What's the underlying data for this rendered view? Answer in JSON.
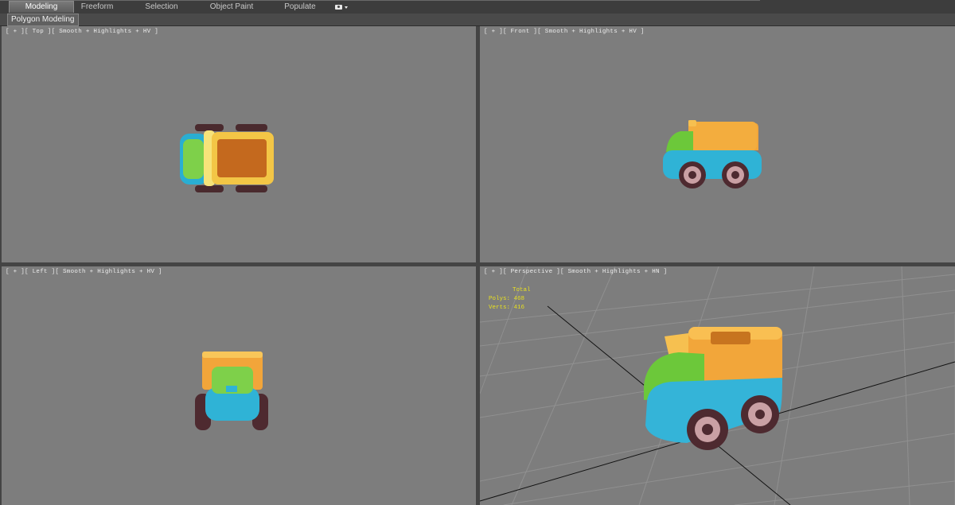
{
  "ribbon": {
    "tabs": [
      {
        "label": "Modeling",
        "active": true
      },
      {
        "label": "Freeform",
        "active": false
      },
      {
        "label": "Selection",
        "active": false
      },
      {
        "label": "Object Paint",
        "active": false
      },
      {
        "label": "Populate",
        "active": false
      }
    ],
    "extra_icons": [
      "camera-icon",
      "chevron-down-icon"
    ]
  },
  "subpanel": {
    "label": "Polygon Modeling"
  },
  "viewports": {
    "top": {
      "label": "[ + ][ Top ][ Smooth + Highlights + HV ]"
    },
    "front": {
      "label": "[ + ][ Front ][ Smooth + Highlights + HV ]"
    },
    "left": {
      "label": "[ + ][ Left ][ Smooth + Highlights + HV ]"
    },
    "perspective": {
      "label": "[ + ][ Perspective ][ Smooth + Highlights + HN ]",
      "stats": {
        "title": "Total",
        "polys": "Polys: 468",
        "verts": "Verts: 416"
      }
    }
  },
  "colors": {
    "viewport_bg": "#7d7d7d",
    "stats_text": "#e8e020",
    "truck_body": "#2ab4d6",
    "truck_cab": "#6cc83a",
    "truck_bed": "#f2a63a",
    "wheel": "#5a3036"
  }
}
